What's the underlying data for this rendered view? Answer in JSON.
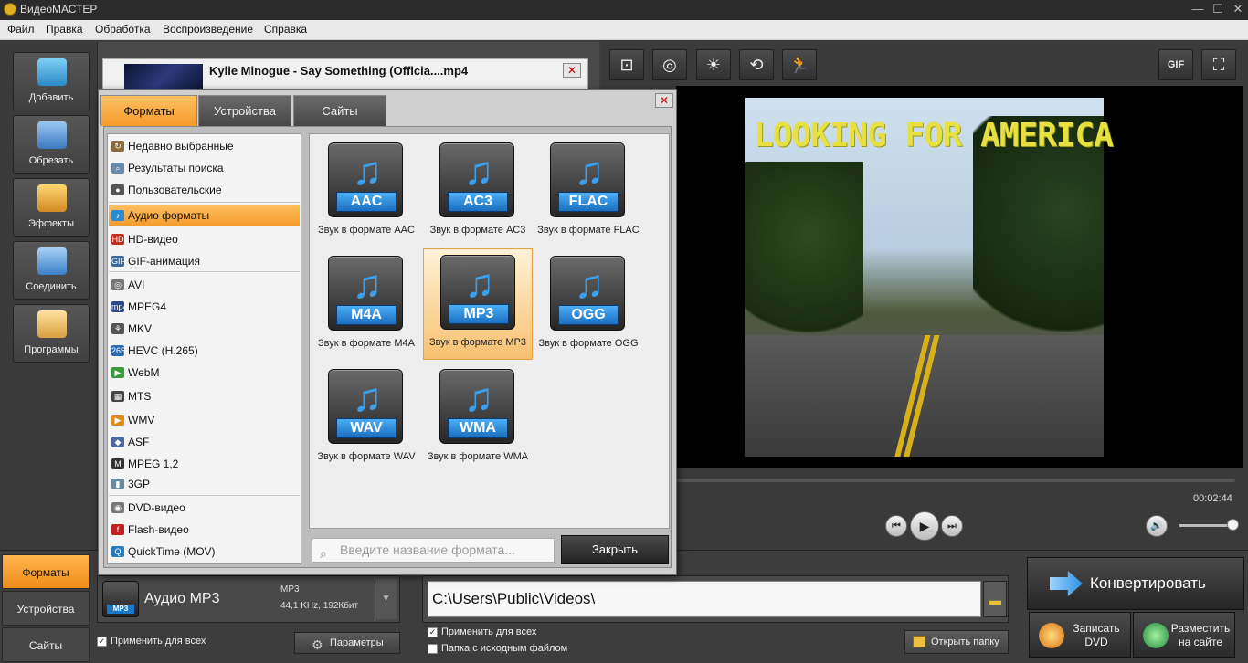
{
  "app": {
    "title": "ВидеоМАСТЕР"
  },
  "window_controls": {
    "minimize": "—",
    "maximize": "☐",
    "close": "✕"
  },
  "menu": [
    "Файл",
    "Правка",
    "Обработка",
    "Воспроизведение",
    "Справка"
  ],
  "rail": [
    {
      "label": "Добавить",
      "icon": "add-video-icon",
      "color": "#4fb8e8"
    },
    {
      "label": "Обрезать",
      "icon": "scissors-icon",
      "color": "#5aa0e0"
    },
    {
      "label": "Эффекты",
      "icon": "magic-wand-icon",
      "color": "#e0a030"
    },
    {
      "label": "Соединить",
      "icon": "join-icon",
      "color": "#70a8e0"
    },
    {
      "label": "Программы",
      "icon": "programs-icon",
      "color": "#e0b050"
    }
  ],
  "file": {
    "name": "Kylie Minogue - Say Something (Officia....mp4",
    "close": "✕"
  },
  "preview": {
    "tools": [
      "crop-icon",
      "watermark-icon",
      "brightness-icon",
      "rotate-icon",
      "speed-icon"
    ],
    "tool_glyphs": [
      "⊡",
      "◎",
      "☀",
      "⟲",
      "🏃"
    ],
    "right_tools": [
      "gif-icon",
      "fullscreen-icon"
    ],
    "gif_label": "GIF",
    "fullscreen_glyph": "⛶",
    "video_text": "LOOKING FOR AMERICA",
    "time": "00:02:44",
    "play_glyphs": {
      "prev": "⏮",
      "play": "▶",
      "next": "⏭",
      "volume": "🔊"
    }
  },
  "dialog": {
    "tabs": [
      "Форматы",
      "Устройства",
      "Сайты"
    ],
    "close": "✕",
    "categories": [
      {
        "label": "Недавно выбранные",
        "icon": "recent-icon",
        "glyph": "↻",
        "color": "#8a6a3a"
      },
      {
        "label": "Результаты поиска",
        "icon": "search-results-icon",
        "glyph": "⌕",
        "color": "#6a8aaa"
      },
      {
        "label": "Пользовательские",
        "icon": "user-icon",
        "glyph": "●",
        "color": "#555"
      },
      {
        "label": "Аудио форматы",
        "icon": "audio-note-icon",
        "glyph": "♪",
        "color": "#2a8ad0"
      },
      {
        "label": "HD-видео",
        "icon": "hd-icon",
        "glyph": "HD",
        "color": "#c03020"
      },
      {
        "label": "GIF-анимация",
        "icon": "gif-small-icon",
        "glyph": "GIF",
        "color": "#3a6a9a"
      },
      {
        "label": "AVI",
        "icon": "avi-icon",
        "glyph": "◎",
        "color": "#777"
      },
      {
        "label": "MPEG4",
        "icon": "mp4-icon",
        "glyph": "mp4",
        "color": "#2a4a8a"
      },
      {
        "label": "MKV",
        "icon": "mkv-icon",
        "glyph": "⚘",
        "color": "#555"
      },
      {
        "label": "HEVC (H.265)",
        "icon": "hevc-icon",
        "glyph": "265",
        "color": "#2a6ab0"
      },
      {
        "label": "WebM",
        "icon": "webm-icon",
        "glyph": "▶",
        "color": "#3a9a3a"
      },
      {
        "label": "MTS",
        "icon": "mts-icon",
        "glyph": "▦",
        "color": "#444"
      },
      {
        "label": "WMV",
        "icon": "wmv-icon",
        "glyph": "▶",
        "color": "#e08a1a"
      },
      {
        "label": "ASF",
        "icon": "asf-icon",
        "glyph": "◆",
        "color": "#4a6aa0"
      },
      {
        "label": "MPEG 1,2",
        "icon": "mpeg-icon",
        "glyph": "M",
        "color": "#333"
      },
      {
        "label": "3GP",
        "icon": "phone-icon",
        "glyph": "▮",
        "color": "#6a8aa0"
      },
      {
        "label": "DVD-видео",
        "icon": "dvd-icon",
        "glyph": "◉",
        "color": "#777"
      },
      {
        "label": "Flash-видео",
        "icon": "flash-icon",
        "glyph": "f",
        "color": "#c02020"
      },
      {
        "label": "QuickTime (MOV)",
        "icon": "quicktime-icon",
        "glyph": "Q",
        "color": "#2a7ac0"
      }
    ],
    "formats": [
      {
        "tag": "AAC",
        "caption": "Звук в формате AAC"
      },
      {
        "tag": "AC3",
        "caption": "Звук в формате AC3"
      },
      {
        "tag": "FLAC",
        "caption": "Звук в формате FLAC"
      },
      {
        "tag": "M4A",
        "caption": "Звук в формате M4A"
      },
      {
        "tag": "MP3",
        "caption": "Звук в формате MP3"
      },
      {
        "tag": "OGG",
        "caption": "Звук в формате OGG"
      },
      {
        "tag": "WAV",
        "caption": "Звук в формате WAV"
      },
      {
        "tag": "WMA",
        "caption": "Звук в формате WMA"
      }
    ],
    "note_glyph": "♫",
    "search_placeholder": "Введите название формата...",
    "close_button": "Закрыть"
  },
  "bottom": {
    "side_tabs": [
      "Форматы",
      "Устройства",
      "Сайты"
    ],
    "format": {
      "name": "Аудио MP3",
      "codec": "MP3",
      "rate": "44,1 KHz, 192Кбит",
      "tag": "MP3",
      "drop": "▼"
    },
    "apply_all": "Применить для всех",
    "params_button": "Параметры",
    "path": "C:\\Users\\Public\\Videos\\",
    "source_folder": "Папка с исходным файлом",
    "open_folder": "Открыть папку",
    "convert": "Конвертировать",
    "burn_dvd": "Записать DVD",
    "publish": "Разместить на сайте"
  },
  "colors": {
    "accent": "#f49a2a",
    "dark": "#3d3d3d",
    "blue": "#1c6fc0"
  }
}
